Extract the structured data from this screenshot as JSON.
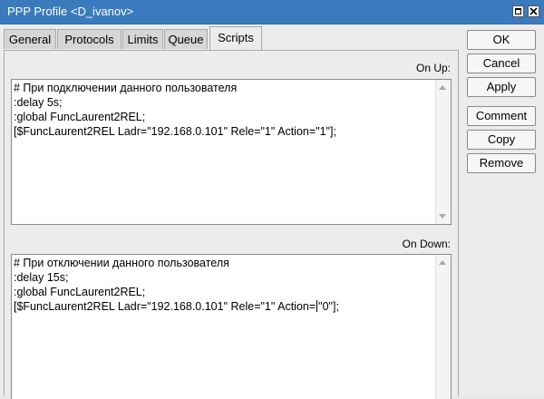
{
  "window": {
    "title": "PPP Profile <D_ivanov>"
  },
  "tabs": [
    {
      "label": "General"
    },
    {
      "label": "Protocols"
    },
    {
      "label": "Limits"
    },
    {
      "label": "Queue"
    },
    {
      "label": "Scripts",
      "active": true
    }
  ],
  "scripts": {
    "on_up": {
      "label": "On Up:",
      "lines": [
        "# При подключении данного пользователя",
        ":delay 5s;",
        ":global FuncLaurent2REL;",
        "[$FuncLaurent2REL Ladr=\"192.168.0.101\" Rele=\"1\" Action=\"1\"];"
      ]
    },
    "on_down": {
      "label": "On Down:",
      "lines": [
        "# При отключении данного пользователя",
        ":delay 15s;",
        ":global FuncLaurent2REL;"
      ],
      "last_line_before_cursor": "[$FuncLaurent2REL Ladr=\"192.168.0.101\" Rele=\"1\" Action=",
      "last_line_after_cursor": "\"0\"];"
    }
  },
  "buttons": {
    "ok": "OK",
    "cancel": "Cancel",
    "apply": "Apply",
    "comment": "Comment",
    "copy": "Copy",
    "remove": "Remove"
  },
  "colors": {
    "titlebar": "#3a7bbd",
    "window_bg": "#ececec"
  }
}
